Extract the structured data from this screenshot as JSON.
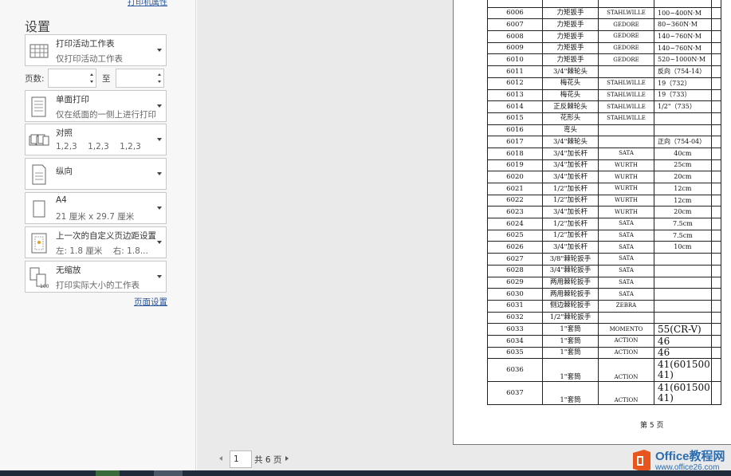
{
  "settings": {
    "printer_properties_link": "打印机属性",
    "title": "设置",
    "print_what": {
      "label": "打印活动工作表",
      "sub": "仅打印活动工作表"
    },
    "pages": {
      "label": "页数:",
      "to": "至",
      "from_value": "",
      "to_value": ""
    },
    "sides": {
      "label": "单面打印",
      "sub": "仅在纸面的一侧上进行打印"
    },
    "collate": {
      "label": "对照",
      "sub": "1,2,3    1,2,3    1,2,3"
    },
    "orientation": {
      "label": "纵向",
      "sub": ""
    },
    "paper": {
      "label": "A4",
      "sub": "21 厘米 x 29.7 厘米"
    },
    "margins": {
      "label": "上一次的自定义页边距设置",
      "sub": "左: 1.8 厘米    右: 1.8..."
    },
    "scaling": {
      "label": "无缩放",
      "sub": "打印实际大小的工作表"
    },
    "page_setup_link": "页面设置"
  },
  "preview": {
    "rows": [
      {
        "id": "",
        "name": "",
        "brand": "",
        "spec": "",
        "big": false
      },
      {
        "id": "6006",
        "name": "力矩扳手",
        "brand": "STAHLWILLE",
        "spec": "100~400N·M",
        "big": false
      },
      {
        "id": "6007",
        "name": "力矩扳手",
        "brand": "GEDORE",
        "spec": "80~360N·M",
        "big": false
      },
      {
        "id": "6008",
        "name": "力矩扳手",
        "brand": "GEDORE",
        "spec": "140~760N·M",
        "big": false
      },
      {
        "id": "6009",
        "name": "力矩扳手",
        "brand": "GEDORE",
        "spec": "140~760N·M",
        "big": false
      },
      {
        "id": "6010",
        "name": "力矩扳手",
        "brand": "GEDORE",
        "spec": "520~1000N·M",
        "big": false
      },
      {
        "id": "6011",
        "name": "3/4\"棘轮头",
        "brand": "",
        "spec": "反向（754-14）",
        "big": false
      },
      {
        "id": "6012",
        "name": "梅花头",
        "brand": "STAHLWILLE",
        "spec": "19（732）",
        "big": false
      },
      {
        "id": "6013",
        "name": "梅花头",
        "brand": "STAHLWILLE",
        "spec": "19（733）",
        "big": false
      },
      {
        "id": "6014",
        "name": "正反棘轮头",
        "brand": "STAHLWILLE",
        "spec": "1/2\"（735）",
        "big": false
      },
      {
        "id": "6015",
        "name": "花形头",
        "brand": "STAHLWILLE",
        "spec": "",
        "big": false
      },
      {
        "id": "6016",
        "name": "弯头",
        "brand": "",
        "spec": "",
        "big": false
      },
      {
        "id": "6017",
        "name": "3/4\"棘轮头",
        "brand": "",
        "spec": "正向（754-04）",
        "big": false
      },
      {
        "id": "6018",
        "name": "3/4\"加长杆",
        "brand": "SATA",
        "spec": "40cm",
        "big": false
      },
      {
        "id": "6019",
        "name": "3/4\"加长杆",
        "brand": "WURTH",
        "spec": "25cm",
        "big": false
      },
      {
        "id": "6020",
        "name": "3/4\"加长杆",
        "brand": "WURTH",
        "spec": "20cm",
        "big": false
      },
      {
        "id": "6021",
        "name": "1/2\"加长杆",
        "brand": "WURTH",
        "spec": "12cm",
        "big": false
      },
      {
        "id": "6022",
        "name": "1/2\"加长杆",
        "brand": "WURTH",
        "spec": "12cm",
        "big": false
      },
      {
        "id": "6023",
        "name": "3/4\"加长杆",
        "brand": "WURTH",
        "spec": "20cm",
        "big": false
      },
      {
        "id": "6024",
        "name": "1/2\"加长杆",
        "brand": "SATA",
        "spec": "7.5cm",
        "big": false
      },
      {
        "id": "6025",
        "name": "1/2\"加长杆",
        "brand": "SATA",
        "spec": "7.5cm",
        "big": false
      },
      {
        "id": "6026",
        "name": "3/4\"加长杆",
        "brand": "SATA",
        "spec": "10cm",
        "big": false
      },
      {
        "id": "6027",
        "name": "3/8\"棘轮扳手",
        "brand": "SATA",
        "spec": "",
        "big": false
      },
      {
        "id": "6028",
        "name": "3/4\"棘轮扳手",
        "brand": "SATA",
        "spec": "",
        "big": false
      },
      {
        "id": "6029",
        "name": "两用棘轮扳手",
        "brand": "SATA",
        "spec": "",
        "big": false
      },
      {
        "id": "6030",
        "name": "两用棘轮扳手",
        "brand": "SATA",
        "spec": "",
        "big": false
      },
      {
        "id": "6031",
        "name": "侧边棘轮扳手",
        "brand": "ZEBRA",
        "spec": "",
        "big": false
      },
      {
        "id": "6032",
        "name": "1/2\"棘轮扳手",
        "brand": "",
        "spec": "",
        "big": false
      },
      {
        "id": "6033",
        "name": "1\"套筒",
        "brand": "MOMENTO",
        "spec": "55(CR-V)",
        "big": true
      },
      {
        "id": "6034",
        "name": "1\"套筒",
        "brand": "ACTION",
        "spec": "46",
        "big": true
      },
      {
        "id": "6035",
        "name": "1\"套筒",
        "brand": "ACTION",
        "spec": "46",
        "big": true
      },
      {
        "id": "6036",
        "name": "1\"套筒",
        "brand": "ACTION",
        "spec": "41(601500 41)",
        "big": true,
        "tall": true
      },
      {
        "id": "6037",
        "name": "1\"套筒",
        "brand": "ACTION",
        "spec": "41(601500 41)",
        "big": true,
        "tall": true
      }
    ],
    "page_label": "第 5 页"
  },
  "navigation": {
    "current_page": "1",
    "total": "共 6 页"
  },
  "watermark": {
    "line1": "Office教程网",
    "line2": "www.office26.com"
  }
}
